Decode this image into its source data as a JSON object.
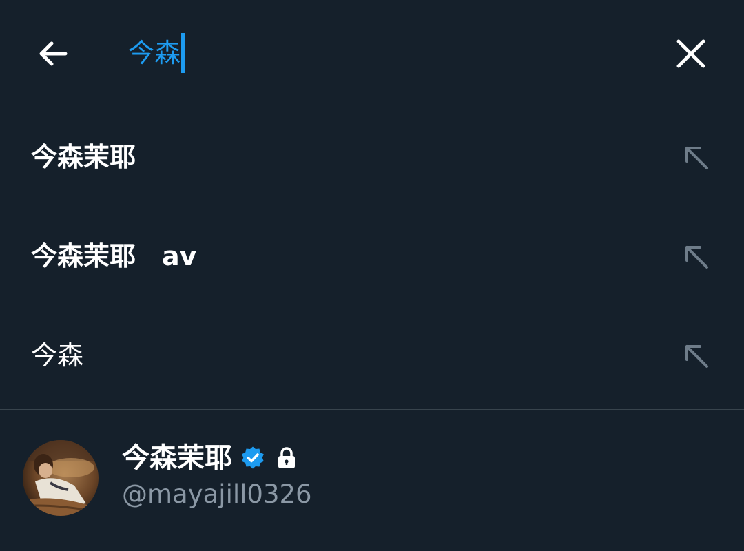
{
  "search": {
    "query": "今森",
    "back_icon": "arrow-left-icon",
    "clear_icon": "close-icon",
    "accent_color": "#1d9bf0"
  },
  "suggestions": [
    {
      "text": "今森茉耶",
      "icon": "arrow-up-left-icon"
    },
    {
      "text": "今森茉耶　av",
      "icon": "arrow-up-left-icon"
    },
    {
      "text": "今森",
      "icon": "arrow-up-left-icon"
    }
  ],
  "user_result": {
    "display_name": "今森茉耶",
    "handle": "@mayajill0326",
    "verified_icon": "verified-badge-icon",
    "protected_icon": "lock-icon",
    "avatar": "profile-photo"
  },
  "colors": {
    "background": "#15202b",
    "divider": "#38444d",
    "secondary_text": "#8b98a5",
    "icon_muted": "#6e7c89"
  }
}
